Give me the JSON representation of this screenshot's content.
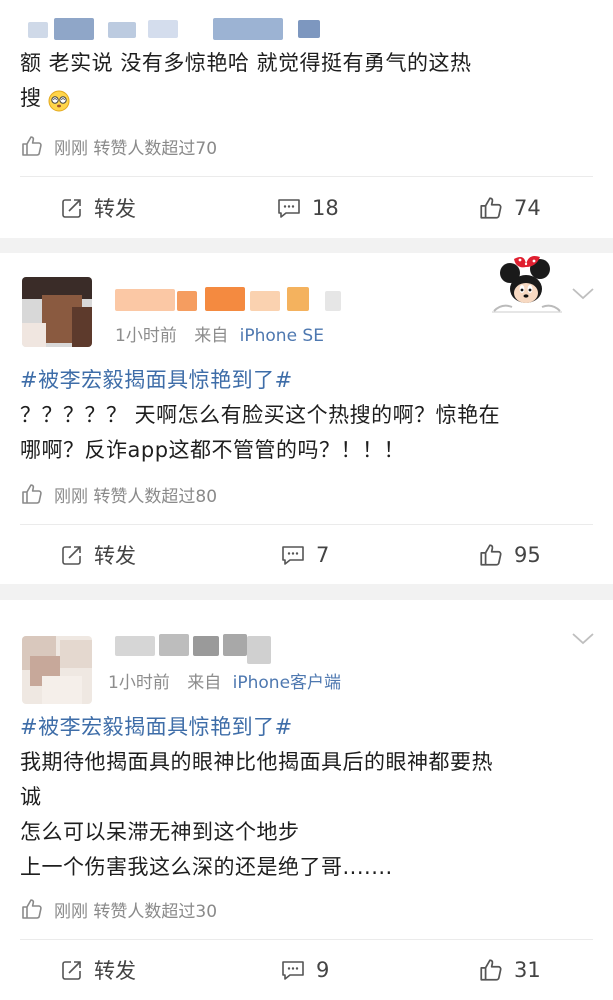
{
  "posts": [
    {
      "text_lines": [
        "额  老实说  没有多惊艳哈  就觉得挺有勇气的这热",
        "搜"
      ],
      "emoji_icon": "dizzy-emoji-icon",
      "likes_info": "刚刚  转赞人数超过70",
      "actions": {
        "forward": "转发",
        "comments": "18",
        "likes": "74"
      }
    },
    {
      "meta_time": "1小时前",
      "meta_from": "来自",
      "meta_device": "iPhone SE",
      "topic": "#被李宏毅揭面具惊艳到了#",
      "text_lines": [
        "？？？？？ 天啊怎么有脸买这个热搜的啊？惊艳在",
        "哪啊？反诈app这都不管管的吗？！！！"
      ],
      "likes_info": "刚刚  转赞人数超过80",
      "actions": {
        "forward": "转发",
        "comments": "7",
        "likes": "95"
      }
    },
    {
      "meta_time": "1小时前",
      "meta_from": "来自",
      "meta_device": "iPhone客户端",
      "topic": "#被李宏毅揭面具惊艳到了#",
      "text_lines": [
        "我期待他揭面具的眼神比他揭面具后的眼神都要热",
        "诚",
        "怎么可以呆滞无神到这个地步",
        "上一个伤害我这么深的还是绝了哥......."
      ],
      "likes_info": "刚刚  转赞人数超过30",
      "actions": {
        "forward": "转发",
        "comments": "9",
        "likes": "31"
      }
    }
  ],
  "colors": {
    "topic": "#3e6da8",
    "device": "#4e78b0",
    "gray": "#8a8a8a",
    "background": "#f2f2f2"
  }
}
